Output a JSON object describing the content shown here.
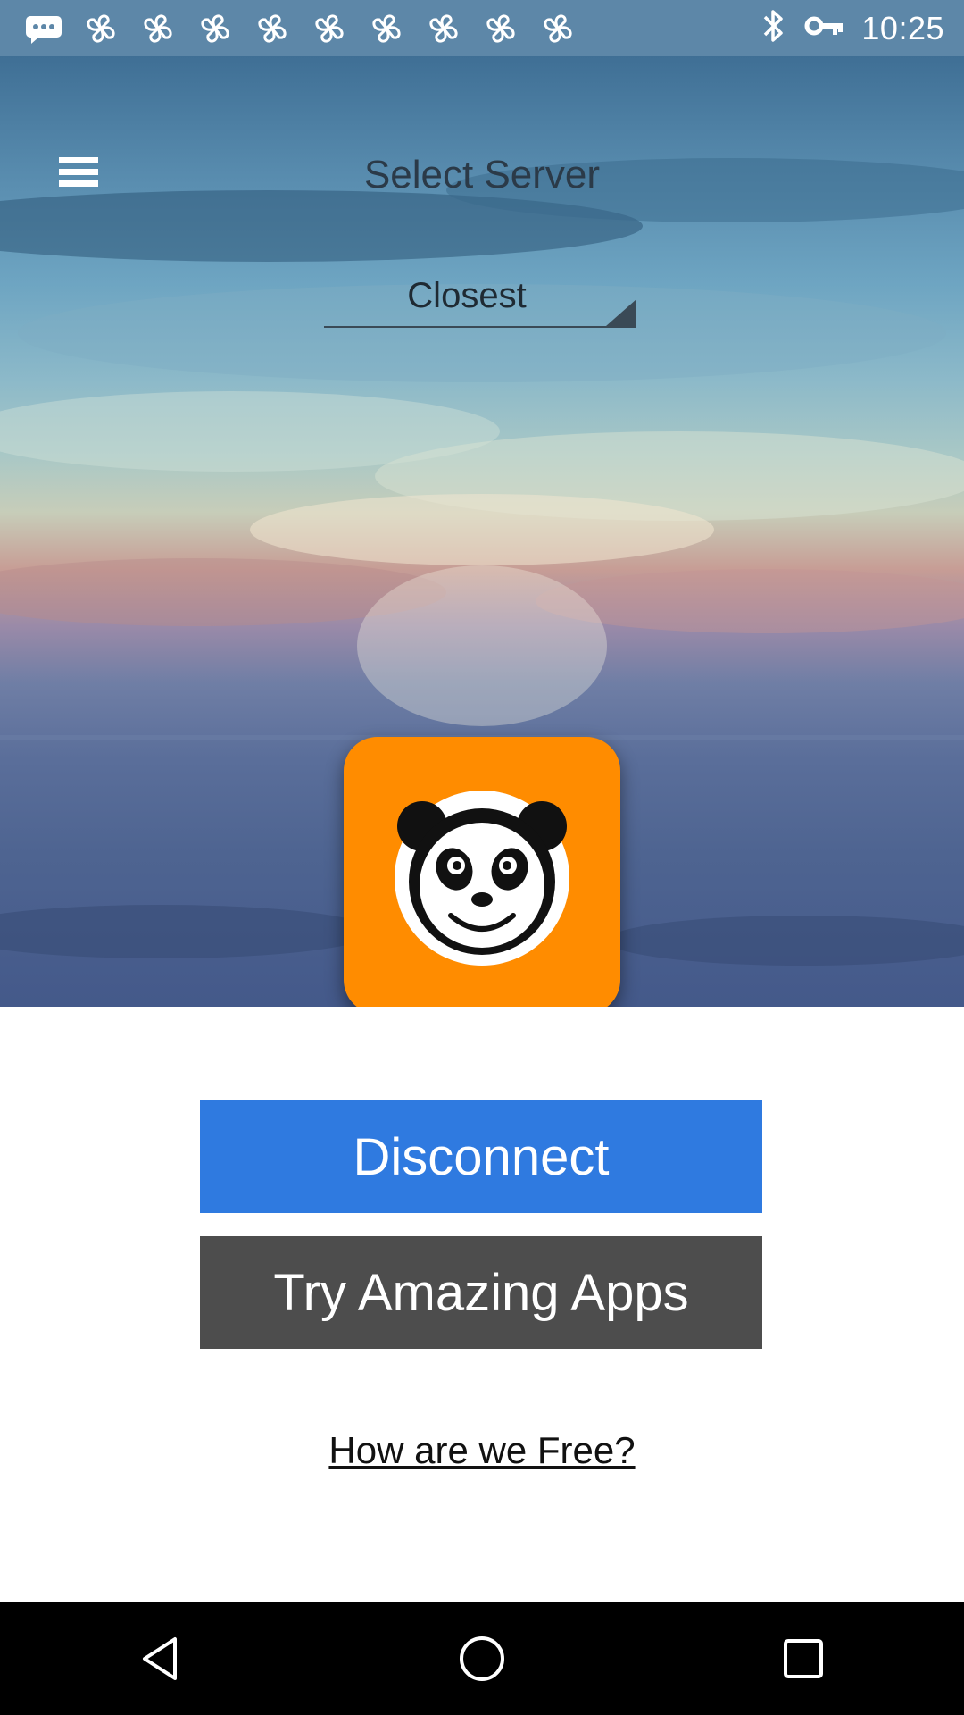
{
  "status_bar": {
    "time": "10:25",
    "notification_icons": [
      "messages-icon",
      "pinwheel-icon",
      "pinwheel-icon",
      "pinwheel-icon",
      "pinwheel-icon",
      "pinwheel-icon",
      "pinwheel-icon",
      "pinwheel-icon",
      "pinwheel-icon",
      "pinwheel-icon"
    ],
    "system_icons": [
      "bluetooth-icon",
      "vpn-key-icon"
    ]
  },
  "header": {
    "title": "Select Server",
    "menu_icon": "hamburger-menu-icon"
  },
  "server_select": {
    "value": "Closest"
  },
  "logo": {
    "icon": "panda-logo-icon",
    "color": "#ff8c00"
  },
  "actions": {
    "disconnect_label": "Disconnect",
    "disconnect_color": "#2f7ae0",
    "apps_label": "Try Amazing Apps",
    "apps_color": "#4d4d4d",
    "free_link_label": "How are we Free?"
  },
  "nav_bar": {
    "back_icon": "back-triangle-icon",
    "home_icon": "home-circle-icon",
    "recents_icon": "recents-square-icon"
  }
}
